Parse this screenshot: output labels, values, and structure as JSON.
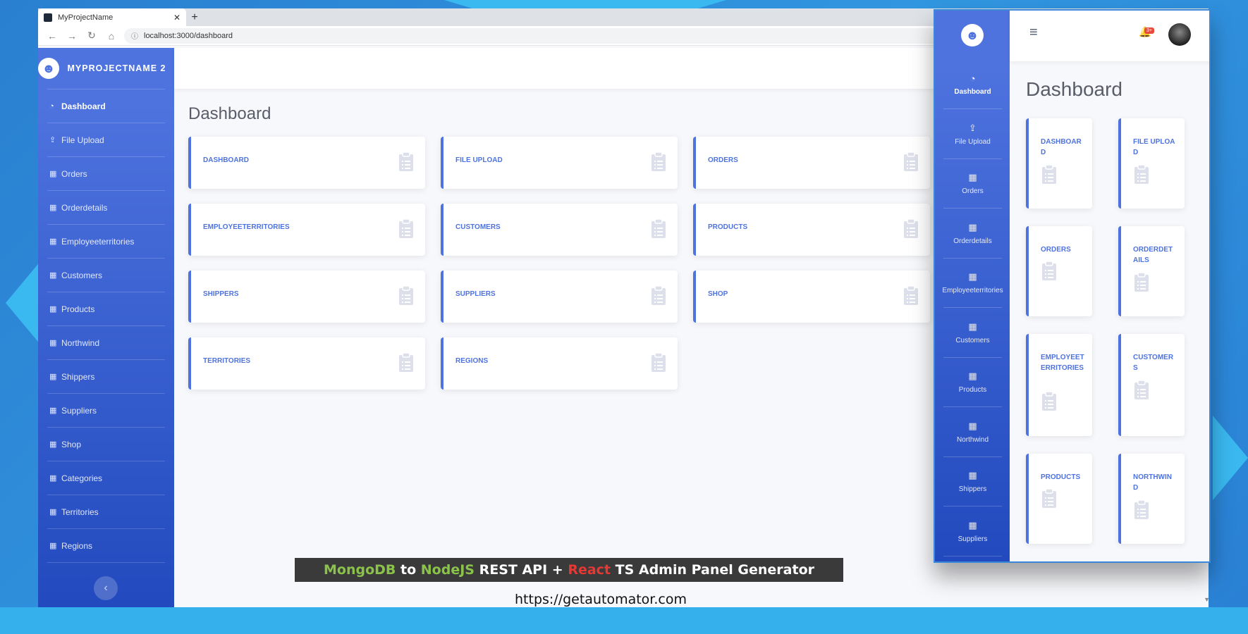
{
  "browser": {
    "tab_title": "MyProjectName",
    "url": "localhost:3000/dashboard"
  },
  "sidebar": {
    "brand": "MYPROJECTNAME 2",
    "items": [
      {
        "label": "Dashboard",
        "icon": "dashboard-icon",
        "active": true
      },
      {
        "label": "File Upload",
        "icon": "upload-icon"
      },
      {
        "label": "Orders",
        "icon": "table-icon"
      },
      {
        "label": "Orderdetails",
        "icon": "table-icon"
      },
      {
        "label": "Employeeterritories",
        "icon": "table-icon"
      },
      {
        "label": "Customers",
        "icon": "table-icon"
      },
      {
        "label": "Products",
        "icon": "table-icon"
      },
      {
        "label": "Northwind",
        "icon": "table-icon"
      },
      {
        "label": "Shippers",
        "icon": "table-icon"
      },
      {
        "label": "Suppliers",
        "icon": "table-icon"
      },
      {
        "label": "Shop",
        "icon": "table-icon"
      },
      {
        "label": "Categories",
        "icon": "table-icon"
      },
      {
        "label": "Territories",
        "icon": "table-icon"
      },
      {
        "label": "Regions",
        "icon": "table-icon"
      }
    ]
  },
  "main": {
    "title": "Dashboard",
    "cards": [
      "DASHBOARD",
      "FILE UPLOAD",
      "ORDERS",
      "EMPLOYEETERRITORIES",
      "CUSTOMERS",
      "PRODUCTS",
      "SHIPPERS",
      "SUPPLIERS",
      "SHOP",
      "TERRITORIES",
      "REGIONS"
    ]
  },
  "banner": {
    "part1": "MongoDB",
    "part2": " to ",
    "part3": "NodeJS",
    "part4": " REST API + ",
    "part5": "React",
    "part6": " TS Admin Panel Generator"
  },
  "caption_url": "https://getautomator.com",
  "mobile": {
    "title": "Dashboard",
    "badge": "3+",
    "nav": [
      "Dashboard",
      "File Upload",
      "Orders",
      "Orderdetails",
      "Employeeterritories",
      "Customers",
      "Products",
      "Northwind",
      "Shippers",
      "Suppliers"
    ],
    "cards": [
      "DASHBOARD",
      "FILE UPLOAD",
      "ORDERS",
      "ORDERDETAILS",
      "EMPLOYEETERRITORIES",
      "CUSTOMERS",
      "PRODUCTS",
      "NORTHWIND"
    ]
  },
  "colors": {
    "primary": "#4e73df",
    "sidebar_end": "#224abe",
    "text_muted": "#5a5c69",
    "banner_green": "#8bc34a",
    "banner_red": "#e53935"
  }
}
